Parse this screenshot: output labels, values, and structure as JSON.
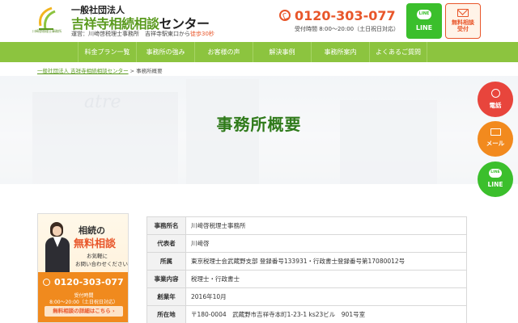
{
  "header": {
    "logo_text": "川崎啓税理士事務所",
    "org_type": "一般社団法人",
    "org_name_main": "吉祥寺相続相談",
    "org_name_suffix": "センター",
    "operator": "運営：川﨑啓税理士事務所　吉祥寺駅東口から",
    "walk": "徒歩30秒",
    "phone": "0120-303-077",
    "hours": "受付時間 8:00～20:00（土日祝日対応）",
    "line_btn_logo": "LINE",
    "line_btn": "LINE",
    "mail_btn_line1": "無料相談",
    "mail_btn_line2": "受付"
  },
  "nav": {
    "items": [
      {
        "label": "料金プラン一覧"
      },
      {
        "label": "事務所の強み"
      },
      {
        "label": "お客様の声"
      },
      {
        "label": "解決事例"
      },
      {
        "label": "事務所案内"
      },
      {
        "label": "よくあるご質問"
      }
    ]
  },
  "breadcrumb": {
    "home": "一般社団法人 吉祥寺相続相談センター",
    "separator": " > ",
    "current": "事務所概要"
  },
  "hero": {
    "bg_text": "atre",
    "title": "事務所概要"
  },
  "promo": {
    "line1": "相続の",
    "line2": "無料相談",
    "sub1": "お気軽に",
    "sub2": "お問い合わせください!",
    "phone": "0120-303-077",
    "hours1": "受付時間",
    "hours2": "8:00～20:00（土日祝日対応）",
    "detail": "無料相談の詳細はこちら ›"
  },
  "info": {
    "rows": [
      {
        "label": "事務所名",
        "value": "川﨑啓税理士事務所"
      },
      {
        "label": "代表者",
        "value": "川﨑啓"
      },
      {
        "label": "所属",
        "value": "東京税理士会武蔵野支部 登録番号133931・行政書士登録番号第17080012号"
      },
      {
        "label": "事業内容",
        "value": "税理士・行政書士"
      },
      {
        "label": "創業年",
        "value": "2016年10月"
      },
      {
        "label": "所在地",
        "value": "〒180-0004　武蔵野市吉祥寺本町1-23-1 ks23ビル　901号室"
      }
    ]
  },
  "float": {
    "tel": "電話",
    "mail": "メール",
    "line_logo": "LINE",
    "line": "LINE"
  },
  "colors": {
    "brand_green": "#8cc43f",
    "title_green": "#2f7a1a",
    "accent_orange": "#e8562a",
    "line_green": "#3bbf2c"
  }
}
